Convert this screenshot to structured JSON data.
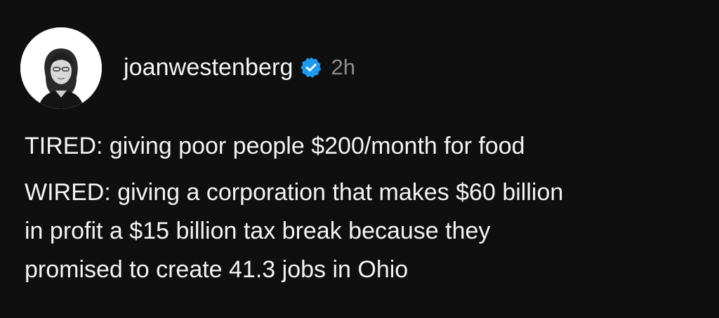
{
  "post": {
    "author": {
      "username": "joanwestenberg",
      "verified": true,
      "verified_icon": "verified-badge-icon",
      "avatar_icon": "profile-photo"
    },
    "timestamp": "2h",
    "paragraphs": [
      "TIRED: giving poor people $200/month for food",
      "WIRED: giving a corporation that makes $60 billion\nin profit a $15 billion tax break because they\npromised to create 41.3 jobs in Ohio"
    ]
  },
  "colors": {
    "background": "#0f0f10",
    "text": "#f3f3f3",
    "muted": "#8e8e8e",
    "verified_blue": "#1d9bf0"
  }
}
